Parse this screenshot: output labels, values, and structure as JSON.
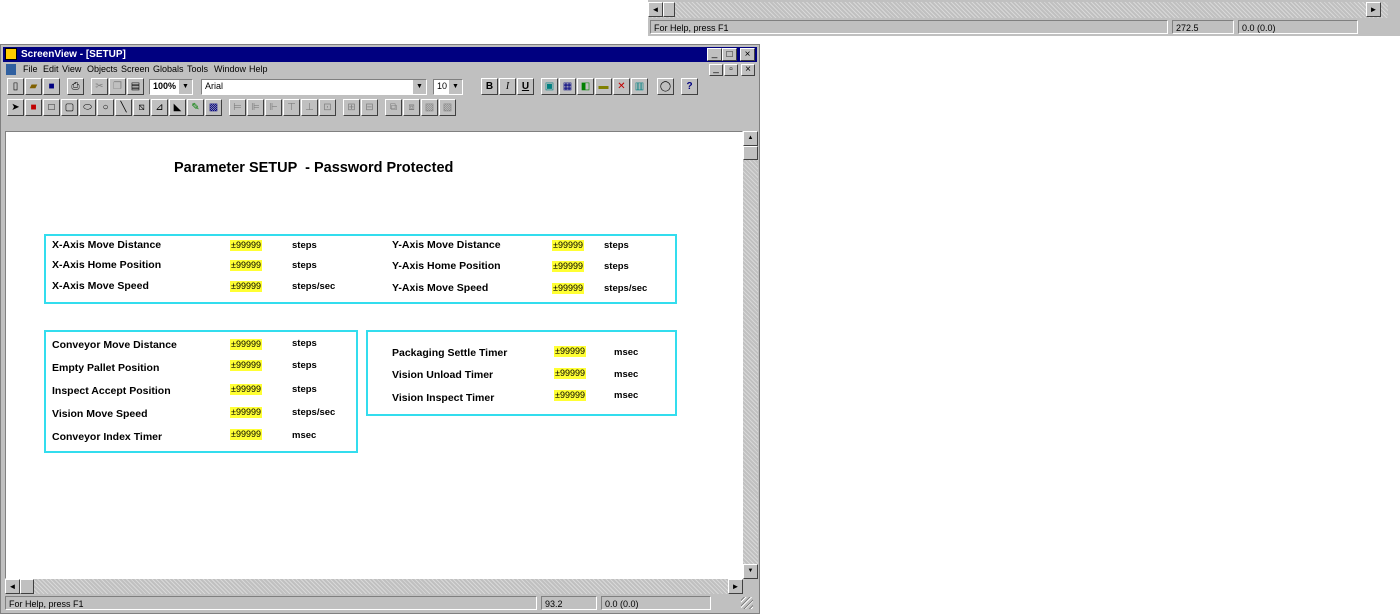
{
  "bg_window": {
    "status_help": "For Help, press F1",
    "status_coord1": "272.5",
    "status_coord2": "0.0 (0.0)"
  },
  "window": {
    "title": "ScreenView - [SETUP]",
    "min_btn": "_",
    "max_btn": "□",
    "close_btn": "×",
    "doc_min_btn": "_",
    "doc_restore_btn": "▫",
    "doc_close_btn": "×"
  },
  "menu": [
    "File",
    "Edit",
    "View",
    "Objects",
    "Screen",
    "Globals",
    "Tools",
    "Window",
    "Help"
  ],
  "toolbar": {
    "zoom": "100%",
    "font": "Arial",
    "font_size": "10",
    "bold": "B",
    "italic": "I",
    "underline": "U"
  },
  "screen": {
    "title": "Parameter SETUP  - Password Protected",
    "x_axis": [
      {
        "label": "X-Axis Move Distance",
        "value": "±99999",
        "unit": "steps"
      },
      {
        "label": "X-Axis Home Position",
        "value": "±99999",
        "unit": "steps"
      },
      {
        "label": "X-Axis Move Speed",
        "value": "±99999",
        "unit": "steps/sec"
      }
    ],
    "y_axis": [
      {
        "label": "Y-Axis Move Distance",
        "value": "±99999",
        "unit": "steps"
      },
      {
        "label": "Y-Axis Home Position",
        "value": "±99999",
        "unit": "steps"
      },
      {
        "label": "Y-Axis Move Speed",
        "value": "±99999",
        "unit": "steps/sec"
      }
    ],
    "conveyor": [
      {
        "label": "Conveyor Move Distance",
        "value": "±99999",
        "unit": "steps"
      },
      {
        "label": "Empty Pallet Position",
        "value": "±99999",
        "unit": "steps"
      },
      {
        "label": "Inspect Accept Position",
        "value": "±99999",
        "unit": "steps"
      },
      {
        "label": "Vision Move Speed",
        "value": "±99999",
        "unit": "steps/sec"
      },
      {
        "label": "Conveyor Index Timer",
        "value": "±99999",
        "unit": "msec"
      }
    ],
    "timers": [
      {
        "label": "Packaging Settle Timer",
        "value": "±99999",
        "unit": "msec"
      },
      {
        "label": "Vision Unload Timer",
        "value": "±99999",
        "unit": "msec"
      },
      {
        "label": "Vision Inspect Timer",
        "value": "±99999",
        "unit": "msec"
      }
    ]
  },
  "statusbar": {
    "help": "For Help, press F1",
    "coord1": "93.2",
    "coord2": "0.0 (0.0)"
  },
  "scroll": {
    "left": "◄",
    "right": "►",
    "up": "▲",
    "down": "▼"
  }
}
